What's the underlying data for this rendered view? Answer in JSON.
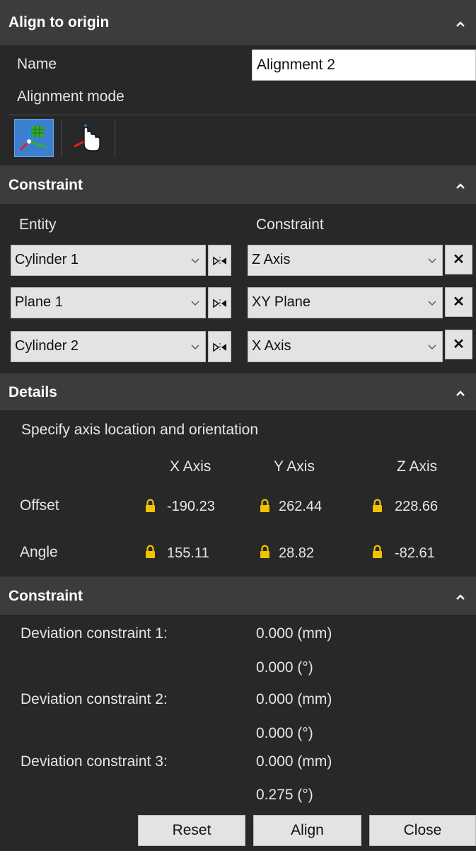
{
  "header": {
    "title": "Align to origin"
  },
  "name_field": {
    "label": "Name",
    "value": "Alignment 2"
  },
  "alignment_mode": {
    "label": "Alignment mode",
    "modes": [
      "axis-alignment-icon",
      "manual-pick-icon"
    ],
    "selected": 0
  },
  "constraint_section": {
    "title": "Constraint",
    "entity_header": "Entity",
    "constraint_header": "Constraint",
    "rows": [
      {
        "entity": "Cylinder 1",
        "constraint": "Z Axis"
      },
      {
        "entity": "Plane 1",
        "constraint": "XY Plane"
      },
      {
        "entity": "Cylinder 2",
        "constraint": "X Axis"
      }
    ],
    "delete_label": "✕"
  },
  "details_section": {
    "title": "Details",
    "description": "Specify axis location and orientation",
    "columns": [
      "X Axis",
      "Y Axis",
      "Z Axis"
    ],
    "offset_label": "Offset",
    "offset": [
      "-190.23",
      "262.44",
      "228.66"
    ],
    "angle_label": "Angle",
    "angle": [
      "155.11",
      "28.82",
      "-82.61"
    ]
  },
  "deviation_section": {
    "title": "Constraint",
    "items": [
      {
        "label": "Deviation constraint 1:",
        "mm": "0.000 (mm)",
        "deg": "0.000 (°)"
      },
      {
        "label": "Deviation constraint 2:",
        "mm": "0.000 (mm)",
        "deg": "0.000 (°)"
      },
      {
        "label": "Deviation constraint 3:",
        "mm": "0.000 (mm)",
        "deg": "0.275 (°)"
      }
    ]
  },
  "footer": {
    "reset_label": "Reset",
    "align_label": "Align",
    "close_label": "Close"
  },
  "colors": {
    "background": "#282828",
    "header": "#3c3c3c",
    "lock": "#f2c200",
    "selected_mode": "#3d7fcf"
  }
}
